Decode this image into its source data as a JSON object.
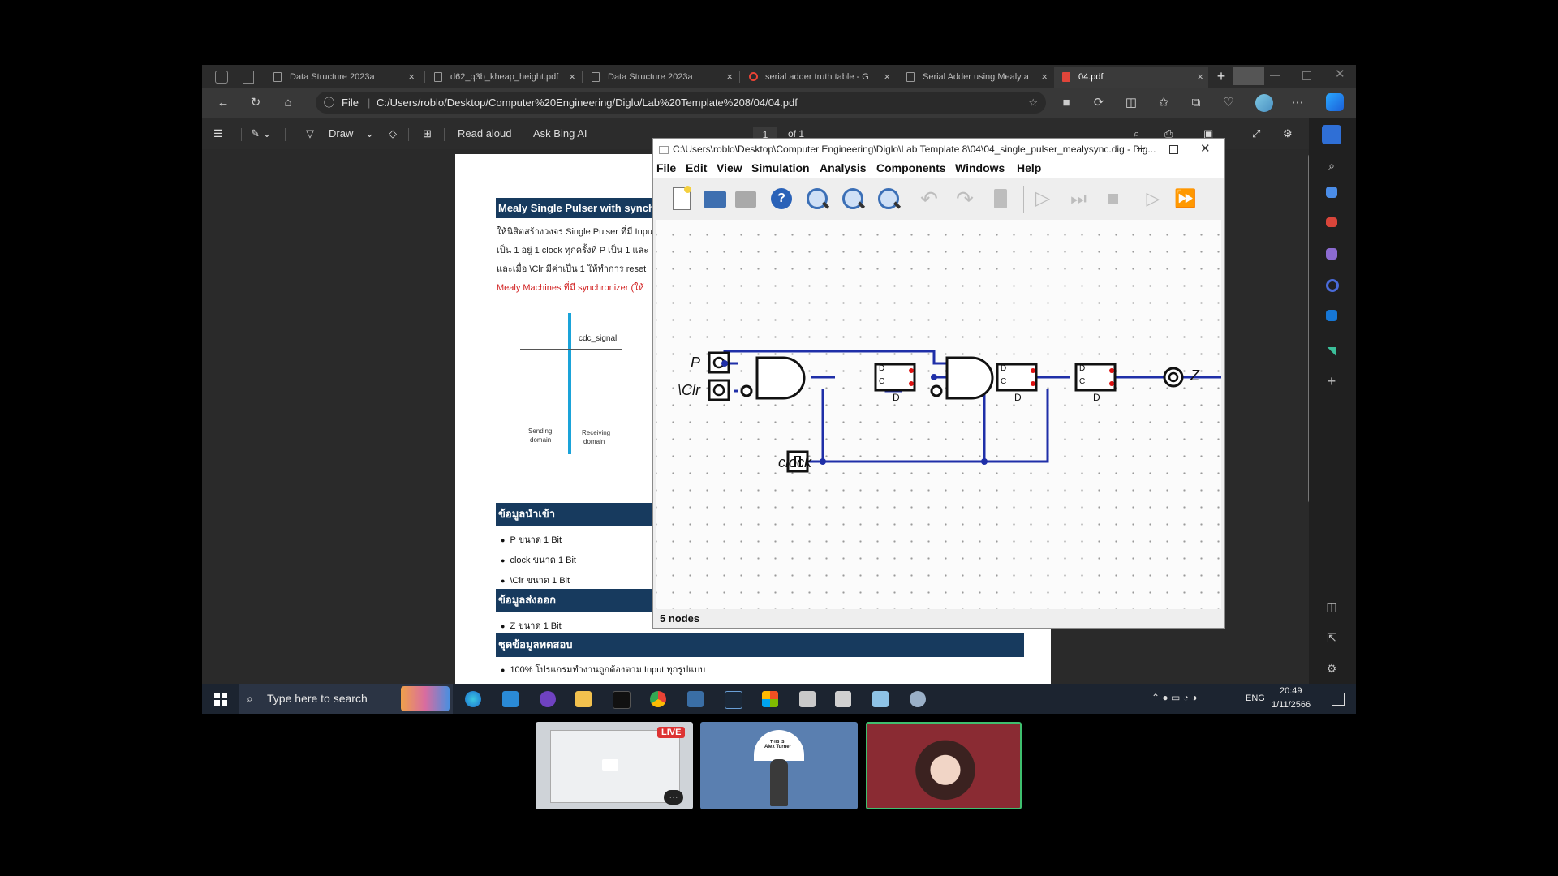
{
  "browser": {
    "tabs": [
      {
        "label": "Data Structure 2023a",
        "close": "×",
        "active": false
      },
      {
        "label": "d62_q3b_kheap_height.pdf",
        "close": "×",
        "active": false
      },
      {
        "label": "Data Structure 2023a",
        "close": "×",
        "active": false
      },
      {
        "label": "serial adder truth table - G",
        "close": "×",
        "active": false
      },
      {
        "label": "Serial Adder using Mealy a",
        "close": "×",
        "active": false
      },
      {
        "label": "04.pdf",
        "close": "×",
        "active": true
      }
    ],
    "new_tab": "+",
    "address": {
      "scheme_label": "File",
      "url": "C:/Users/roblo/Desktop/Computer%20Engineering/Diglo/Lab%20Template%208/04/04.pdf"
    },
    "pdf_toolbar": {
      "draw_label": "Draw",
      "read_aloud_label": "Read aloud",
      "ask_bing_label": "Ask Bing AI",
      "page_number": "1",
      "page_of": "of 1"
    }
  },
  "pdf": {
    "section_title": "Mealy Single Pulser with synch",
    "lines": [
      "ให้นิสิตสร้างวงจร Single Pulser ที่มี Input",
      "เป็น 1 อยู่ 1 clock ทุกครั้งที่ P เป็น 1 และ",
      "และเมื่อ \\Clr มีค่าเป็น 1 ให้ทำการ reset",
      "Mealy Machines ที่มี synchronizer (ให้"
    ],
    "figure": {
      "signal_label": "cdc_signal",
      "left_label_1": "Sending",
      "left_label_2": "domain",
      "right_label_1": "Receiving",
      "right_label_2": "domain"
    },
    "inputs_heading": "ข้อมูลนำเข้า",
    "inputs": [
      "P ขนาด 1 Bit",
      "clock ขนาด 1 Bit",
      "\\Clr ขนาด 1 Bit"
    ],
    "outputs_heading": "ข้อมูลส่งออก",
    "outputs": [
      "Z ขนาด 1 Bit"
    ],
    "tests_heading": "ชุดข้อมูลทดสอบ",
    "tests": [
      "100% โปรแกรมทำงานถูกต้องตาม Input ทุกรูปแบบ"
    ]
  },
  "digital": {
    "title": "C:\\Users\\roblo\\Desktop\\Computer Engineering\\Diglo\\Lab Template 8\\04\\04_single_pulser_mealysync.dig - Dig...",
    "menu": [
      "File",
      "Edit",
      "View",
      "Simulation",
      "Analysis",
      "Components",
      "Windows",
      "Help"
    ],
    "circuit": {
      "input_p": "P",
      "input_clr": "\\Clr",
      "clock_label": "clock",
      "output_label": "Z",
      "ff_pin_d": "D",
      "ff_pin_c": "C",
      "ff_name": "D"
    },
    "status": "5 nodes"
  },
  "taskbar": {
    "search_placeholder": "Type here to search",
    "lang": "ENG",
    "time": "20:49",
    "date": "1/11/2566"
  },
  "thumbnails": {
    "live_badge": "LIVE",
    "more": "···",
    "avatar_caption_1": "THIS IS",
    "avatar_caption_2": "Alex Turner"
  },
  "colors": {
    "wire": "#1f2fa8",
    "pdf_header": "#173a5e",
    "edge_accent": "#3a8ee6"
  }
}
